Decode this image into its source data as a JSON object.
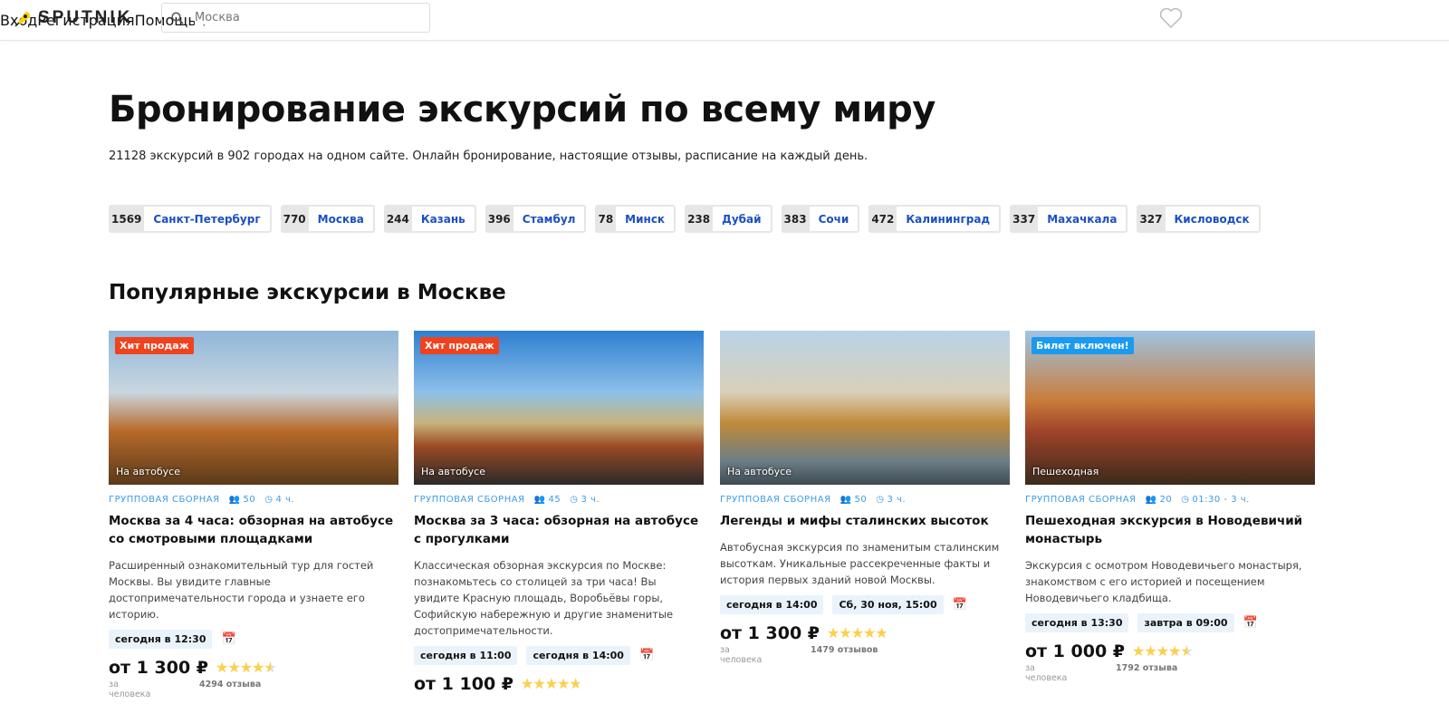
{
  "header": {
    "logo": "SPUTNIK",
    "search_value": "Москва",
    "nav": [
      "Вход",
      "Регистрация",
      "Помощь"
    ]
  },
  "hero": {
    "title": "Бронирование экскурсий по всему миру",
    "subtitle": "21128 экскурсий в 902 городах на одном сайте. Онлайн бронирование, настоящие отзывы, расписание на каждый день."
  },
  "cities": [
    {
      "count": "1569",
      "name": "Санкт-Петербург"
    },
    {
      "count": "770",
      "name": "Москва"
    },
    {
      "count": "244",
      "name": "Казань"
    },
    {
      "count": "396",
      "name": "Стамбул"
    },
    {
      "count": "78",
      "name": "Минск"
    },
    {
      "count": "238",
      "name": "Дубай"
    },
    {
      "count": "383",
      "name": "Сочи"
    },
    {
      "count": "472",
      "name": "Калининград"
    },
    {
      "count": "337",
      "name": "Махачкала"
    },
    {
      "count": "327",
      "name": "Кисловодск"
    }
  ],
  "section_title": "Популярные экскурсии в Москве",
  "cards": [
    {
      "badge": "Хит продаж",
      "badge_color": "#f0421e",
      "transport": "На автобусе",
      "type": "ГРУППОВАЯ СБОРНАЯ",
      "group": "50",
      "duration": "4 ч.",
      "title": "Москва за 4 часа: обзорная на автобусе со смотровыми площадками",
      "desc": "Расширенный ознакомительный тур для гостей Москвы. Вы увидите главные достопримечательности города и узнаете его историю.",
      "dates": [
        "сегодня в 12:30"
      ],
      "price": "от 1 300 ₽",
      "per": "за человека",
      "rating": 4.6,
      "reviews": "4294 отзыва"
    },
    {
      "badge": "Хит продаж",
      "badge_color": "#f0421e",
      "transport": "На автобусе",
      "type": "ГРУППОВАЯ СБОРНАЯ",
      "group": "45",
      "duration": "3 ч.",
      "title": "Москва за 3 часа: обзорная на автобусе с прогулками",
      "desc": "Классическая обзорная экскурсия по Москве: познакомьтесь со столицей за три часа! Вы увидите Красную площадь, Воробьёвы горы, Софийскую набережную и другие знаменитые достопримечательности.",
      "dates": [
        "сегодня в 11:00",
        "сегодня в 14:00"
      ],
      "price": "от 1 100 ₽",
      "per": "",
      "rating": 4.8,
      "reviews": ""
    },
    {
      "badge": "",
      "badge_color": "",
      "transport": "На автобусе",
      "type": "ГРУППОВАЯ СБОРНАЯ",
      "group": "50",
      "duration": "3 ч.",
      "title": "Легенды и мифы сталинских высоток",
      "desc": "Автобусная экскурсия по знаменитым сталинским высоткам. Уникальные рассекреченные факты и история первых зданий новой Москвы.",
      "dates": [
        "сегодня в 14:00",
        "Сб, 30 ноя, 15:00"
      ],
      "price": "от 1 300 ₽",
      "per": "за человека",
      "rating": 4.9,
      "reviews": "1479 отзывов"
    },
    {
      "badge": "Билет включен!",
      "badge_color": "#1a9af0",
      "transport": "Пешеходная",
      "type": "ГРУППОВАЯ СБОРНАЯ",
      "group": "20",
      "duration": "01:30 - 3 ч.",
      "title": "Пешеходная экскурсия в Новодевичий монастырь",
      "desc": "Экскурсия с осмотром Новодевичьего монастыря, знакомством с его историей и посещением Новодевичьего кладбища.",
      "dates": [
        "сегодня в 13:30",
        "завтра в 09:00"
      ],
      "price": "от 1 000 ₽",
      "per": "за человека",
      "rating": 4.6,
      "reviews": "1792 отзыва"
    }
  ]
}
